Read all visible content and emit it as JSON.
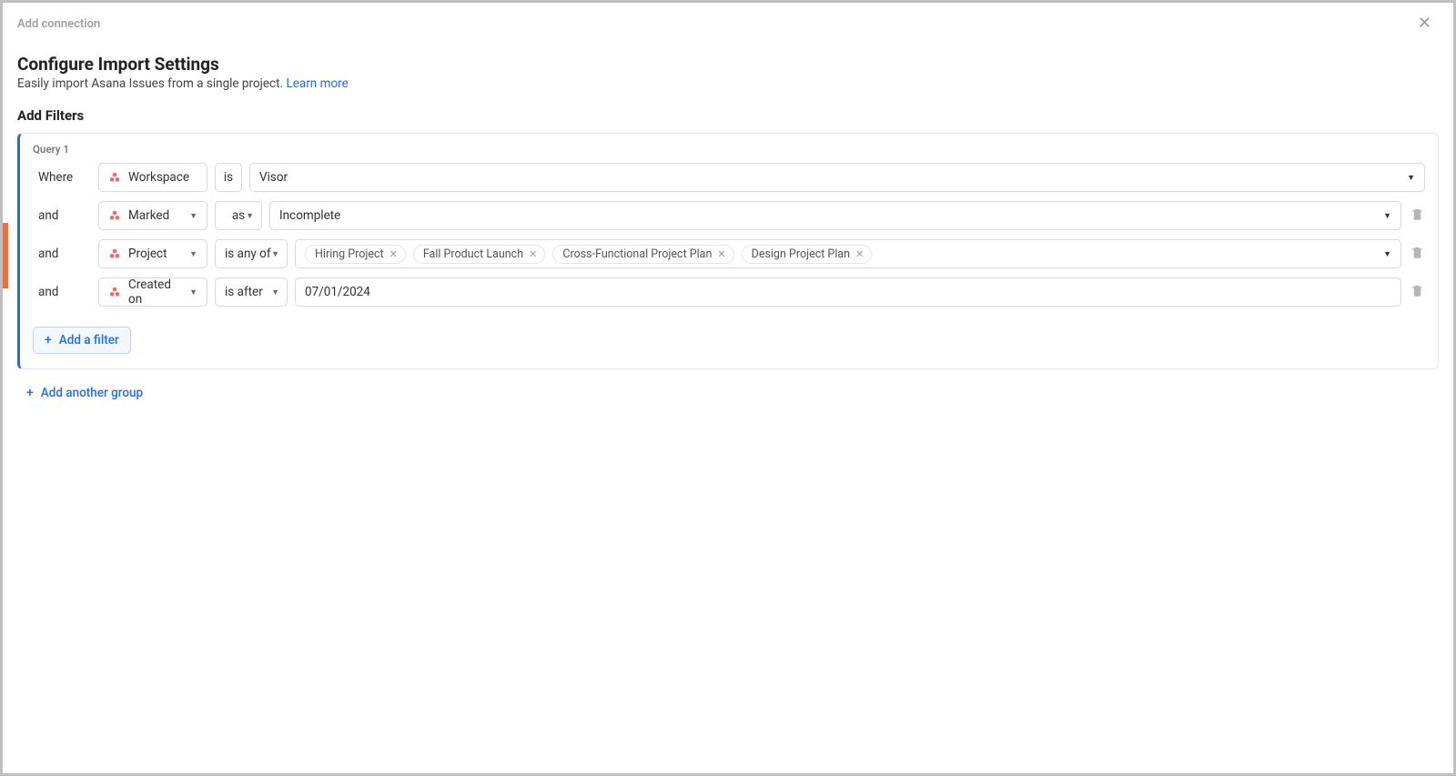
{
  "header": {
    "breadcrumb": "Add connection"
  },
  "page": {
    "title": "Configure Import Settings",
    "subtitle_prefix": "Easily import Asana Issues from a single project. ",
    "learn_more": "Learn more",
    "section_title": "Add Filters"
  },
  "query": {
    "label": "Query 1",
    "rows": [
      {
        "conj": "Where",
        "field": "Workspace",
        "op": "is",
        "value_type": "single",
        "value": "Visor",
        "deletable": false
      },
      {
        "conj": "and",
        "field": "Marked",
        "op": "as",
        "value_type": "single",
        "value": "Incomplete",
        "deletable": true
      },
      {
        "conj": "and",
        "field": "Project",
        "op": "is any of",
        "value_type": "chips",
        "chips": [
          "Hiring Project",
          "Fall Product Launch",
          "Cross-Functional Project Plan",
          "Design Project Plan"
        ],
        "deletable": true
      },
      {
        "conj": "and",
        "field": "Created on",
        "op": "is after",
        "value_type": "date",
        "value": "07/01/2024",
        "deletable": true
      }
    ],
    "add_filter_label": "Add a filter"
  },
  "add_group_label": "Add another group"
}
